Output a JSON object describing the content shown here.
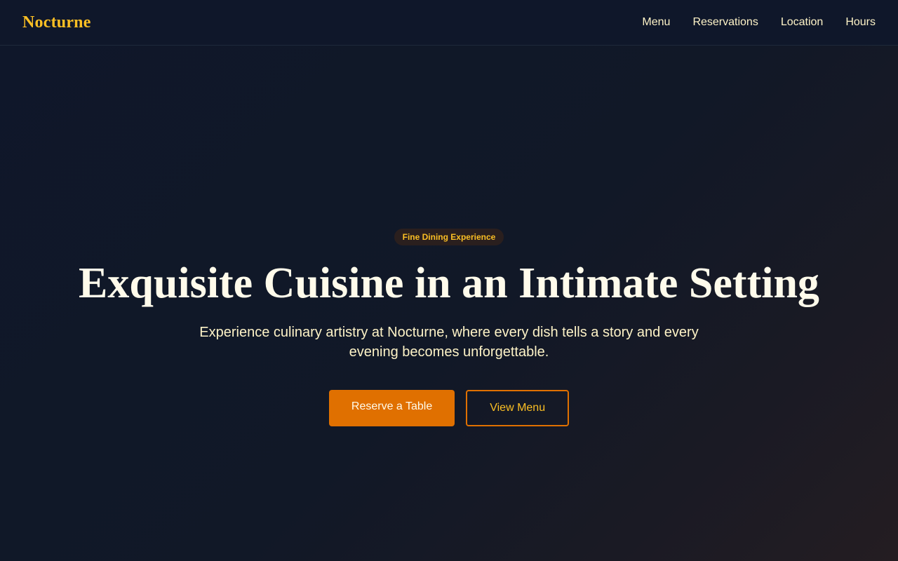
{
  "brand": {
    "name": "Nocturne"
  },
  "nav": {
    "items": [
      {
        "label": "Menu"
      },
      {
        "label": "Reservations"
      },
      {
        "label": "Location"
      },
      {
        "label": "Hours"
      }
    ]
  },
  "hero": {
    "badge": "Fine Dining Experience",
    "title": "Exquisite Cuisine in an Intimate Setting",
    "subtitle": "Experience culinary artistry at Nocturne, where every dish tells a story and every evening becomes unforgettable.",
    "primary_cta": "Reserve a Table",
    "secondary_cta": "View Menu"
  },
  "colors": {
    "background": "#0f172a",
    "accent": "#fbbf24",
    "primary_button": "#e07000",
    "text": "#fef3c7"
  }
}
